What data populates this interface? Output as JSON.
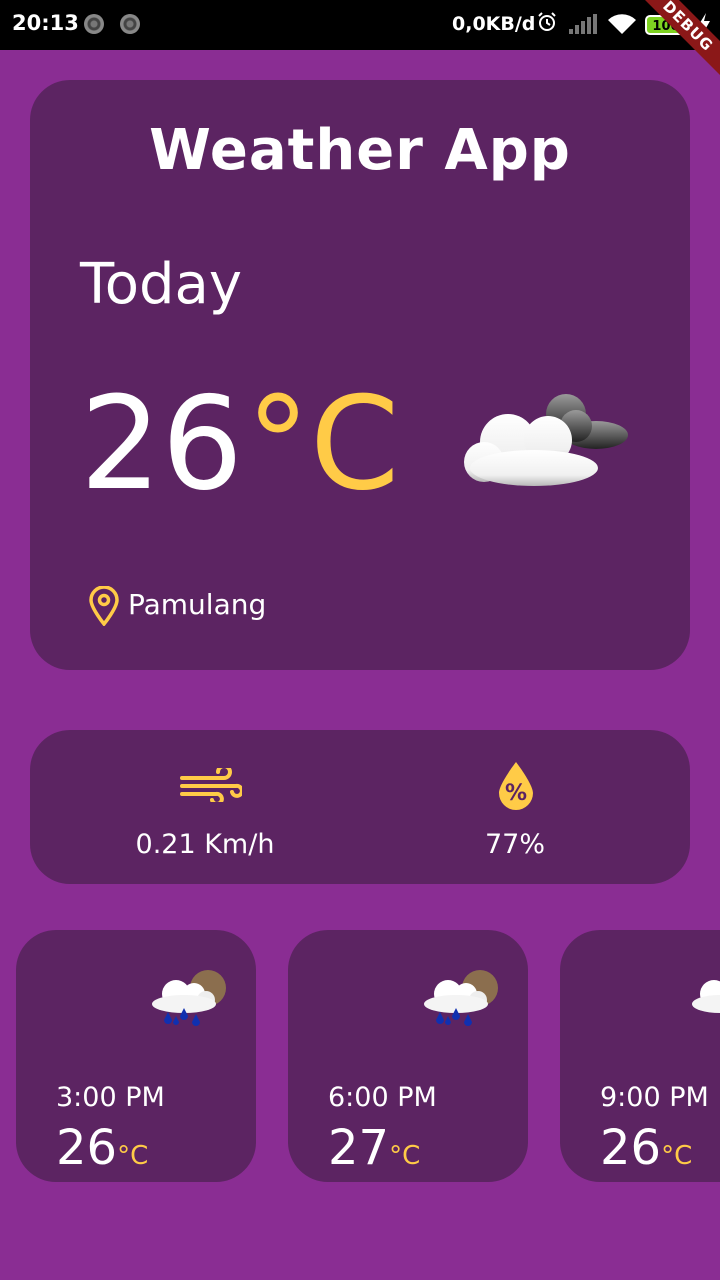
{
  "status_bar": {
    "time": "20:13",
    "network_speed": "0,0KB/d",
    "battery": "100"
  },
  "debug_banner": "DEBUG",
  "app_title": "Weather App",
  "current": {
    "day_label": "Today",
    "temperature": "26",
    "unit": "°C",
    "condition_icon": "partly-cloudy-night-icon",
    "location": "Pamulang"
  },
  "stats": {
    "wind": {
      "icon": "wind-icon",
      "value": "0.21 Km/h"
    },
    "humidity": {
      "icon": "humidity-icon",
      "value": "77%"
    }
  },
  "forecast": [
    {
      "time": "3:00 PM",
      "temperature": "26",
      "unit": "°C",
      "icon": "rain-cloud-icon"
    },
    {
      "time": "6:00 PM",
      "temperature": "27",
      "unit": "°C",
      "icon": "rain-cloud-icon"
    },
    {
      "time": "9:00 PM",
      "temperature": "26",
      "unit": "°C",
      "icon": "cloud-icon"
    }
  ],
  "colors": {
    "background": "#8A2D93",
    "card": "#5C2462",
    "accent": "#FFCB47",
    "text": "#FFFFFF"
  }
}
